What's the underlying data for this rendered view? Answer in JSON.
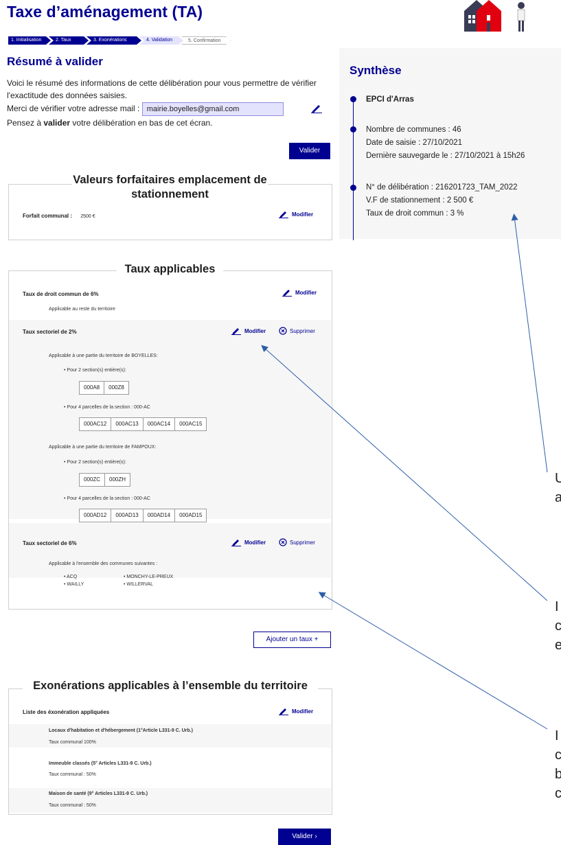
{
  "header": {
    "title": "Taxe d’aménagement (TA)"
  },
  "stepper": [
    {
      "label": "1. Initialisation",
      "state": "done"
    },
    {
      "label": "2. Taux",
      "state": "done"
    },
    {
      "label": "3. Exonérations",
      "state": "done"
    },
    {
      "label": "4. Validation",
      "state": "active"
    },
    {
      "label": "5. Confirmation",
      "state": "todo"
    }
  ],
  "summary": {
    "heading": "Résumé à valider",
    "intro_line1": "Voici le résumé des informations de cette délibération pour vous permettre de vérifier l'exactitude des données saisies.",
    "email_label": "Merci de vérifier votre adresse mail :",
    "email_value": "mairie.boyelles@gmail.com",
    "validate_pre": "Pensez à ",
    "validate_word": "valider",
    "validate_post": " votre délibération en bas de cet écran.",
    "validate_button": "Valider"
  },
  "forfait": {
    "legend": "Valeurs forfaitaires emplacement de stationnement",
    "label": "Forfait communal :",
    "value": "2500 €",
    "modify": "Modifier"
  },
  "taux": {
    "legend": "Taux applicables",
    "modify": "Modifier",
    "delete": "Supprimer",
    "common": {
      "title": "Taux de droit commun de 6%",
      "desc": "Applicable au reste du territoire"
    },
    "sector1": {
      "title": "Taux sectoriel de 2%",
      "groups": [
        {
          "commune": "Applicable à une partie du territoire de BOYELLES:",
          "sections_label": "• Pour 2 section(s) entière(s):",
          "sections": [
            "000A8",
            "000Z8"
          ],
          "parcels_label": "• Pour 4 parcelles de la section : 000-AC",
          "parcels": [
            "000AC12",
            "000AC13",
            "000AC14",
            "000AC15"
          ]
        },
        {
          "commune": "Applicable à une partie du territoire de FAMPOUX:",
          "sections_label": "• Pour 2 section(s) entière(s):",
          "sections": [
            "000ZC",
            "000ZH"
          ],
          "parcels_label": "• Pour 4 parcelles de la section : 000-AC",
          "parcels": [
            "000AD12",
            "000AD13",
            "000AD14",
            "000AD15"
          ]
        }
      ]
    },
    "sector2": {
      "title": "Taux sectoriel de 6%",
      "desc": "Applicable à l'ensemble des communes suivantes :",
      "communes": [
        "• ACQ",
        "• MONCHY-LE-PREUX",
        "• WAILLY",
        "• WILLERVAL"
      ]
    },
    "add_button": "Ajouter un taux  +"
  },
  "exonerations": {
    "legend": "Exonérations applicables à l’ensemble du territoire",
    "list_title": "Liste des éxonération appliquées",
    "modify": "Modifier",
    "items": [
      {
        "title": "Locaux d'habitation et d'hébergement  (1°Article L331-9 C. Urb.)",
        "rate": "Taux communal 100%"
      },
      {
        "title": "Immeuble classés (5° Articles L331-9 C. Urb.)",
        "rate": "Taux communal : 50%"
      },
      {
        "title": "Maison de santé (9° Articles L331-9 C. Urb.)",
        "rate": "Taux communal : 50%"
      }
    ],
    "validate_button": "Valider  ›"
  },
  "synthese": {
    "title": "Synthèse",
    "epci": "EPCI d'Arras",
    "nb_communes": "Nombre de communes  : 46",
    "date_saisie": "Date de saisie : 27/10/2021",
    "derniere": "Dernière sauvegarde le : 27/10/2021 à 15h26",
    "num_delib": "N° de délibération : 216201723_TAM_2022",
    "vf": "V.F de stationnement : 2 500 €",
    "taux": "Taux de droit commun : 3 %"
  },
  "annotations": {
    "a1_l1": "U",
    "a1_l2": "a",
    "a2_l1": "I",
    "a2_l2": "c",
    "a2_l3": "e",
    "a3_l1": "I",
    "a3_l2": "c",
    "a3_l3": "b",
    "a3_l4": "c"
  },
  "colors": {
    "primary": "#000091",
    "light": "#e3e3fd",
    "grey_bg": "#f6f6f6",
    "red": "#e1000f"
  }
}
